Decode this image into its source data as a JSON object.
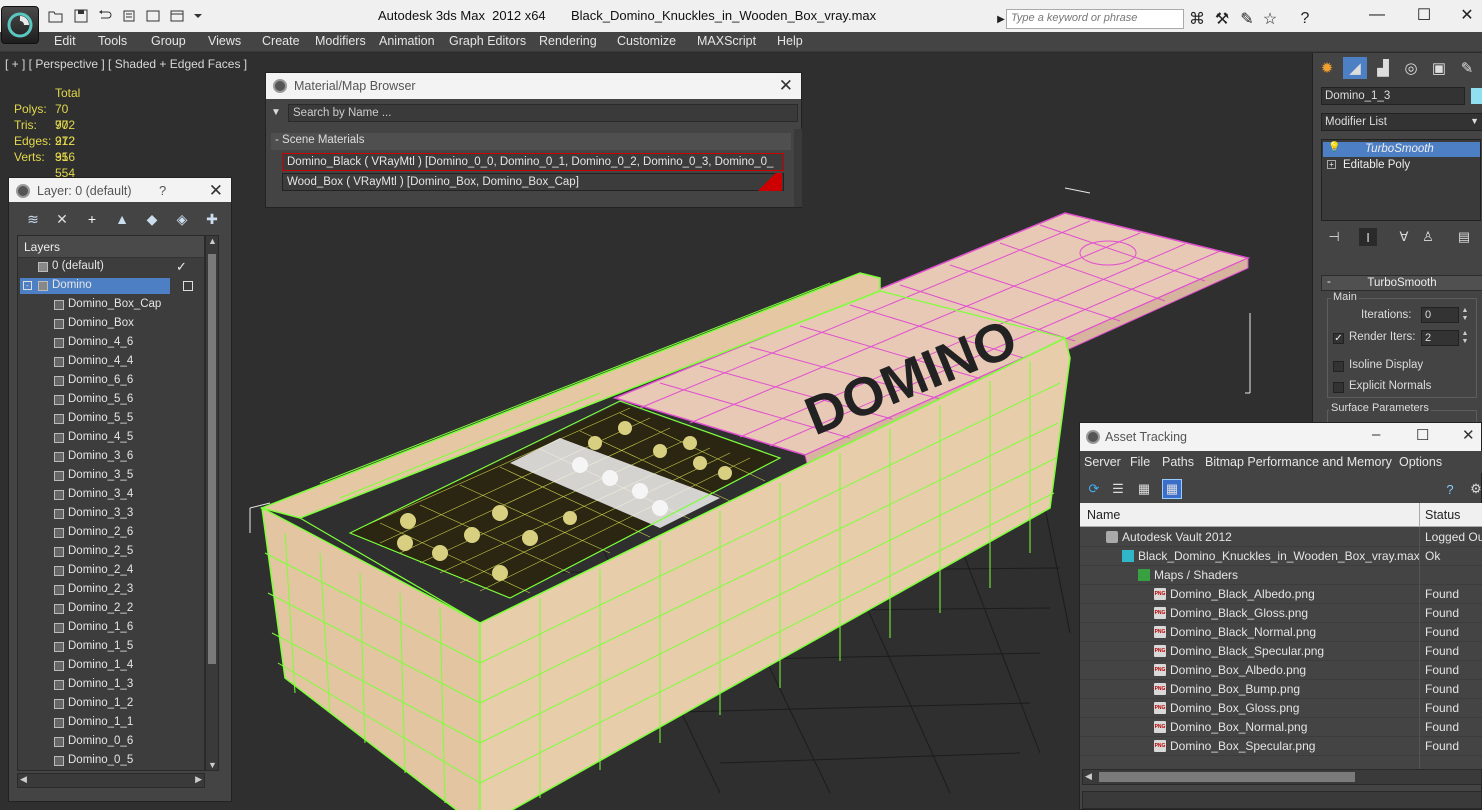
{
  "title_bar": {
    "app_title": "Autodesk 3ds Max  2012 x64       Black_Domino_Knuckles_in_Wooden_Box_vray.max",
    "search_placeholder": "Type a keyword or phrase"
  },
  "menu": [
    "Edit",
    "Tools",
    "Group",
    "Views",
    "Create",
    "Modifiers",
    "Animation",
    "Graph Editors",
    "Rendering",
    "Customize",
    "MAXScript",
    "Help"
  ],
  "viewport": {
    "label": "[ + ] [ Perspective ] [ Shaded + Edged Faces ]",
    "stats": {
      "header": "Total",
      "rows": [
        {
          "label": "Polys:",
          "value": "70 972"
        },
        {
          "label": "Tris:",
          "value": "70 972"
        },
        {
          "label": "Edges:",
          "value": "212 916"
        },
        {
          "label": "Verts:",
          "value": "35 554"
        }
      ]
    },
    "lid_text": "DOMINO"
  },
  "material_browser": {
    "title": "Material/Map Browser",
    "search_placeholder": "Search by Name ...",
    "section": "- Scene Materials",
    "materials": [
      "Domino_Black  ( VRayMtl )  [Domino_0_0, Domino_0_1, Domino_0_2, Domino_0_3, Domino_0_",
      "Wood_Box  ( VRayMtl )  [Domino_Box, Domino_Box_Cap]"
    ]
  },
  "layer_panel": {
    "title": "Layer: 0 (default)",
    "help": "?",
    "header": "Layers",
    "layers": [
      {
        "name": "0 (default)",
        "level": 0
      },
      {
        "name": "Domino",
        "level": 0,
        "selected": true
      },
      {
        "name": "Domino_Box_Cap",
        "level": 1
      },
      {
        "name": "Domino_Box",
        "level": 1
      },
      {
        "name": "Domino_4_6",
        "level": 1
      },
      {
        "name": "Domino_4_4",
        "level": 1
      },
      {
        "name": "Domino_6_6",
        "level": 1
      },
      {
        "name": "Domino_5_6",
        "level": 1
      },
      {
        "name": "Domino_5_5",
        "level": 1
      },
      {
        "name": "Domino_4_5",
        "level": 1
      },
      {
        "name": "Domino_3_6",
        "level": 1
      },
      {
        "name": "Domino_3_5",
        "level": 1
      },
      {
        "name": "Domino_3_4",
        "level": 1
      },
      {
        "name": "Domino_3_3",
        "level": 1
      },
      {
        "name": "Domino_2_6",
        "level": 1
      },
      {
        "name": "Domino_2_5",
        "level": 1
      },
      {
        "name": "Domino_2_4",
        "level": 1
      },
      {
        "name": "Domino_2_3",
        "level": 1
      },
      {
        "name": "Domino_2_2",
        "level": 1
      },
      {
        "name": "Domino_1_6",
        "level": 1
      },
      {
        "name": "Domino_1_5",
        "level": 1
      },
      {
        "name": "Domino_1_4",
        "level": 1
      },
      {
        "name": "Domino_1_3",
        "level": 1
      },
      {
        "name": "Domino_1_2",
        "level": 1
      },
      {
        "name": "Domino_1_1",
        "level": 1
      },
      {
        "name": "Domino_0_6",
        "level": 1
      },
      {
        "name": "Domino_0_5",
        "level": 1
      }
    ]
  },
  "command_panel": {
    "object_name": "Domino_1_3",
    "object_color": "#8fe0f0",
    "modifier_list": "Modifier List",
    "stack": [
      "TurboSmooth",
      "Editable Poly"
    ],
    "rollout_title": "TurboSmooth",
    "group_main": "Main",
    "iterations_label": "Iterations:",
    "iterations_value": "0",
    "render_iters_label": "Render Iters:",
    "render_iters_value": "2",
    "render_iters_checked": true,
    "isoline_label": "Isoline Display",
    "explicit_normals_label": "Explicit Normals",
    "surface_params_label": "Surface Parameters"
  },
  "asset_tracking": {
    "title": "Asset Tracking",
    "menu": [
      "Server",
      "File",
      "Paths",
      "Bitmap Performance and Memory",
      "Options"
    ],
    "columns": {
      "name": "Name",
      "status": "Status"
    },
    "rows": [
      {
        "name": "Autodesk Vault 2012",
        "status": "Logged Ou",
        "level": 0,
        "icon": "vault-icon"
      },
      {
        "name": "Black_Domino_Knuckles_in_Wooden_Box_vray.max",
        "status": "Ok",
        "level": 1,
        "icon": "max-file-icon"
      },
      {
        "name": "Maps / Shaders",
        "status": "",
        "level": 2,
        "icon": "maps-icon"
      },
      {
        "name": "Domino_Black_Albedo.png",
        "status": "Found",
        "level": 3,
        "icon": "png-icon"
      },
      {
        "name": "Domino_Black_Gloss.png",
        "status": "Found",
        "level": 3,
        "icon": "png-icon"
      },
      {
        "name": "Domino_Black_Normal.png",
        "status": "Found",
        "level": 3,
        "icon": "png-icon"
      },
      {
        "name": "Domino_Black_Specular.png",
        "status": "Found",
        "level": 3,
        "icon": "png-icon"
      },
      {
        "name": "Domino_Box_Albedo.png",
        "status": "Found",
        "level": 3,
        "icon": "png-icon"
      },
      {
        "name": "Domino_Box_Bump.png",
        "status": "Found",
        "level": 3,
        "icon": "png-icon"
      },
      {
        "name": "Domino_Box_Gloss.png",
        "status": "Found",
        "level": 3,
        "icon": "png-icon"
      },
      {
        "name": "Domino_Box_Normal.png",
        "status": "Found",
        "level": 3,
        "icon": "png-icon"
      },
      {
        "name": "Domino_Box_Specular.png",
        "status": "Found",
        "level": 3,
        "icon": "png-icon"
      }
    ]
  },
  "colors": {
    "wire_green": "#7dff3a",
    "wire_pink": "#e050d0",
    "wood": "#e7c9a7",
    "stats_yellow": "#e2d84a",
    "selection_blue": "#4d7fc4"
  }
}
